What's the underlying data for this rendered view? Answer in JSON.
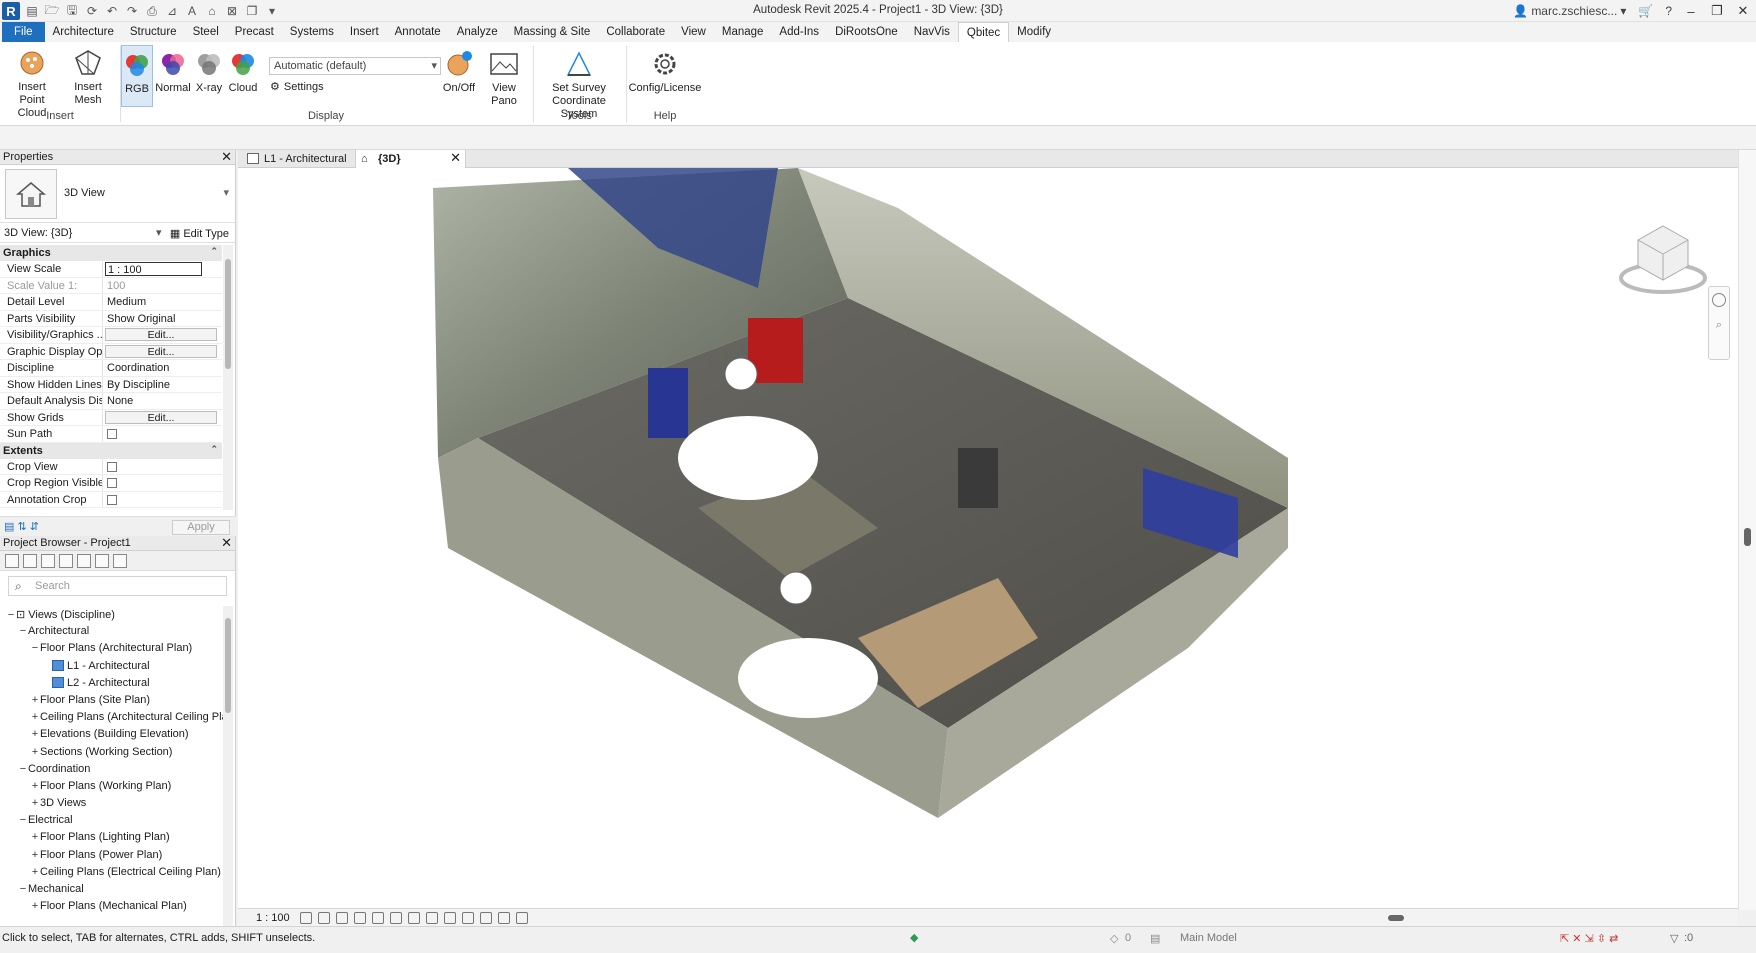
{
  "window": {
    "title": "Autodesk Revit 2025.4 - Project1 - 3D View: {3D}",
    "user": "marc.zschiesc..."
  },
  "menu": [
    "File",
    "Architecture",
    "Structure",
    "Steel",
    "Precast",
    "Systems",
    "Insert",
    "Annotate",
    "Analyze",
    "Massing & Site",
    "Collaborate",
    "View",
    "Manage",
    "Add-Ins",
    "DiRootsOne",
    "NavVis",
    "Qbitec",
    "Modify"
  ],
  "active_tab": "Qbitec",
  "ribbon": {
    "insert_point_cloud": "Insert\nPoint Cloud",
    "insert_point_cloud_1": "Insert",
    "insert_point_cloud_2": "Point Cloud",
    "insert_mesh": "Insert Mesh",
    "rgb": "RGB",
    "normal": "Normal",
    "xray": "X-ray",
    "cloud": "Cloud",
    "display_mode": "Automatic (default)",
    "settings": "Settings",
    "onoff": "On/Off",
    "view_pano": "View Pano",
    "survey_1": "Set Survey",
    "survey_2": "Coordinate System",
    "config": "Config/License",
    "panels": {
      "insert": "Insert",
      "display": "Display",
      "tools": "Tools",
      "help": "Help"
    }
  },
  "properties": {
    "header": "Properties",
    "type_name": "3D View",
    "instance": "3D View: {3D}",
    "edit_type": "Edit Type",
    "groups": {
      "graphics": "Graphics",
      "extents": "Extents"
    },
    "rows": [
      {
        "k": "View Scale",
        "v": "1 : 100"
      },
      {
        "k": "Scale Value    1:",
        "v": "100"
      },
      {
        "k": "Detail Level",
        "v": "Medium"
      },
      {
        "k": "Parts Visibility",
        "v": "Show Original"
      },
      {
        "k": "Visibility/Graphics ...",
        "v": "Edit..."
      },
      {
        "k": "Graphic Display Op...",
        "v": "Edit..."
      },
      {
        "k": "Discipline",
        "v": "Coordination"
      },
      {
        "k": "Show Hidden Lines",
        "v": "By Discipline"
      },
      {
        "k": "Default Analysis Dis...",
        "v": "None"
      },
      {
        "k": "Show Grids",
        "v": "Edit..."
      },
      {
        "k": "Sun Path",
        "v": ""
      }
    ],
    "extents_rows": [
      {
        "k": "Crop View"
      },
      {
        "k": "Crop Region Visible"
      },
      {
        "k": "Annotation Crop"
      }
    ],
    "apply": "Apply"
  },
  "browser": {
    "header": "Project Browser - Project1",
    "search_placeholder": "Search",
    "items": [
      {
        "t": "Views (Discipline)",
        "lvl": 0,
        "ex": "−"
      },
      {
        "t": "Architectural",
        "lvl": 1,
        "ex": "−"
      },
      {
        "t": "Floor Plans (Architectural Plan)",
        "lvl": 2,
        "ex": "−"
      },
      {
        "t": "L1 - Architectural",
        "lvl": 3,
        "ex": "",
        "view": true
      },
      {
        "t": "L2 - Architectural",
        "lvl": 3,
        "ex": "",
        "view": true
      },
      {
        "t": "Floor Plans (Site Plan)",
        "lvl": 2,
        "ex": "+"
      },
      {
        "t": "Ceiling Plans (Architectural Ceiling Pla",
        "lvl": 2,
        "ex": "+"
      },
      {
        "t": "Elevations (Building Elevation)",
        "lvl": 2,
        "ex": "+"
      },
      {
        "t": "Sections (Working Section)",
        "lvl": 2,
        "ex": "+"
      },
      {
        "t": "Coordination",
        "lvl": 1,
        "ex": "−"
      },
      {
        "t": "Floor Plans (Working Plan)",
        "lvl": 2,
        "ex": "+"
      },
      {
        "t": "3D Views",
        "lvl": 2,
        "ex": "+"
      },
      {
        "t": "Electrical",
        "lvl": 1,
        "ex": "−"
      },
      {
        "t": "Floor Plans (Lighting Plan)",
        "lvl": 2,
        "ex": "+"
      },
      {
        "t": "Floor Plans (Power Plan)",
        "lvl": 2,
        "ex": "+"
      },
      {
        "t": "Ceiling Plans (Electrical Ceiling Plan)",
        "lvl": 2,
        "ex": "+"
      },
      {
        "t": "Mechanical",
        "lvl": 1,
        "ex": "−"
      },
      {
        "t": "Floor Plans (Mechanical Plan)",
        "lvl": 2,
        "ex": "+"
      }
    ]
  },
  "tabs": [
    {
      "label": "L1 - Architectural"
    },
    {
      "label": "{3D}"
    }
  ],
  "view_scale": "1 : 100",
  "status": {
    "message": "Click to select, TAB for alternates, CTRL adds, SHIFT unselects.",
    "model": "Main Model",
    "filter_count": ":0",
    "zero": "0"
  }
}
